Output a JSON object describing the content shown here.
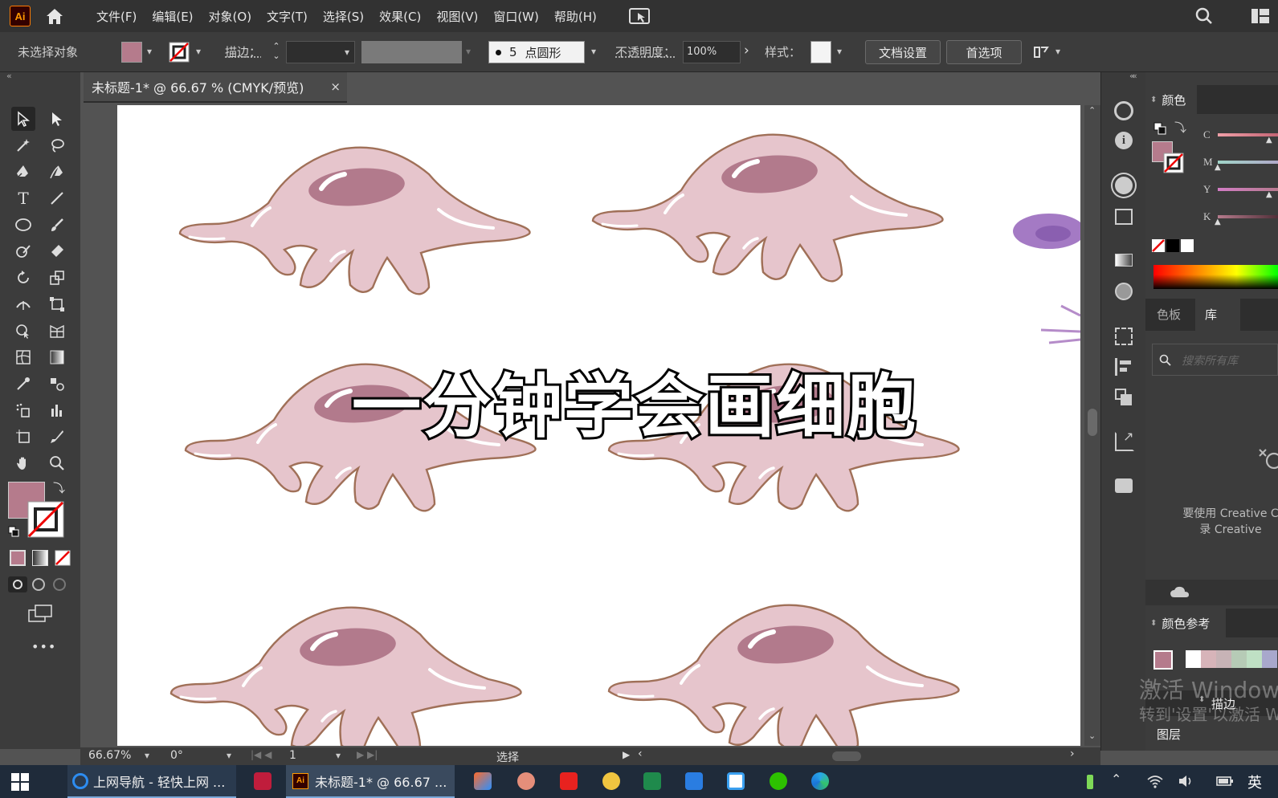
{
  "app": {
    "logo": "Ai",
    "accent": "#ff9a00"
  },
  "menu": [
    "文件(F)",
    "编辑(E)",
    "对象(O)",
    "文字(T)",
    "选择(S)",
    "效果(C)",
    "视图(V)",
    "窗口(W)",
    "帮助(H)"
  ],
  "control": {
    "selection_status": "未选择对象",
    "fill_color": "#b57b8c",
    "stroke_label": "描边：",
    "brush_size": "5",
    "brush_shape": "点圆形",
    "opacity_label": "不透明度：",
    "opacity_value": "100%",
    "style_label": "样式：",
    "doc_setup_button": "文档设置",
    "preferences_button": "首选项"
  },
  "document": {
    "tab_title": "未标题-1* @ 66.67 % (CMYK/预览)",
    "overlay_title": "一分钟学会画细胞",
    "cell_colors": {
      "body": "#e6c5cc",
      "outline": "#a07058",
      "nucleus": "#b27a8c"
    }
  },
  "status": {
    "zoom": "66.67%",
    "rotation": "0°",
    "artboard": "1",
    "tool": "选择"
  },
  "color_panel": {
    "title": "颜色",
    "channels": [
      "C",
      "M",
      "Y",
      "K"
    ],
    "levels": [
      0.8,
      0.0,
      0.8,
      0.0
    ],
    "current": "#b57b8c"
  },
  "library_panel": {
    "tabs": [
      "色板",
      "库"
    ],
    "active_tab": "库",
    "search_placeholder": "搜索所有库",
    "message_line1": "要使用 Creative C",
    "message_line2": "录 Creative"
  },
  "color_guide": {
    "title": "颜色参考",
    "swatches": [
      "#ffffff",
      "#d7b4b9",
      "#c7b3b6",
      "#b6cbb6",
      "#bfe0c4",
      "#a8a8cc"
    ]
  },
  "watermark": {
    "line1": "激活 Window",
    "line2": "转到'设置'以激活 W"
  },
  "bottom_panels": {
    "stroke_tab": "描边",
    "layers": "图层"
  },
  "taskbar": {
    "browser_label": "上网导航 - 轻快上网 ...",
    "ai_label": "未标题-1* @ 66.67 ...",
    "ime": "英"
  }
}
